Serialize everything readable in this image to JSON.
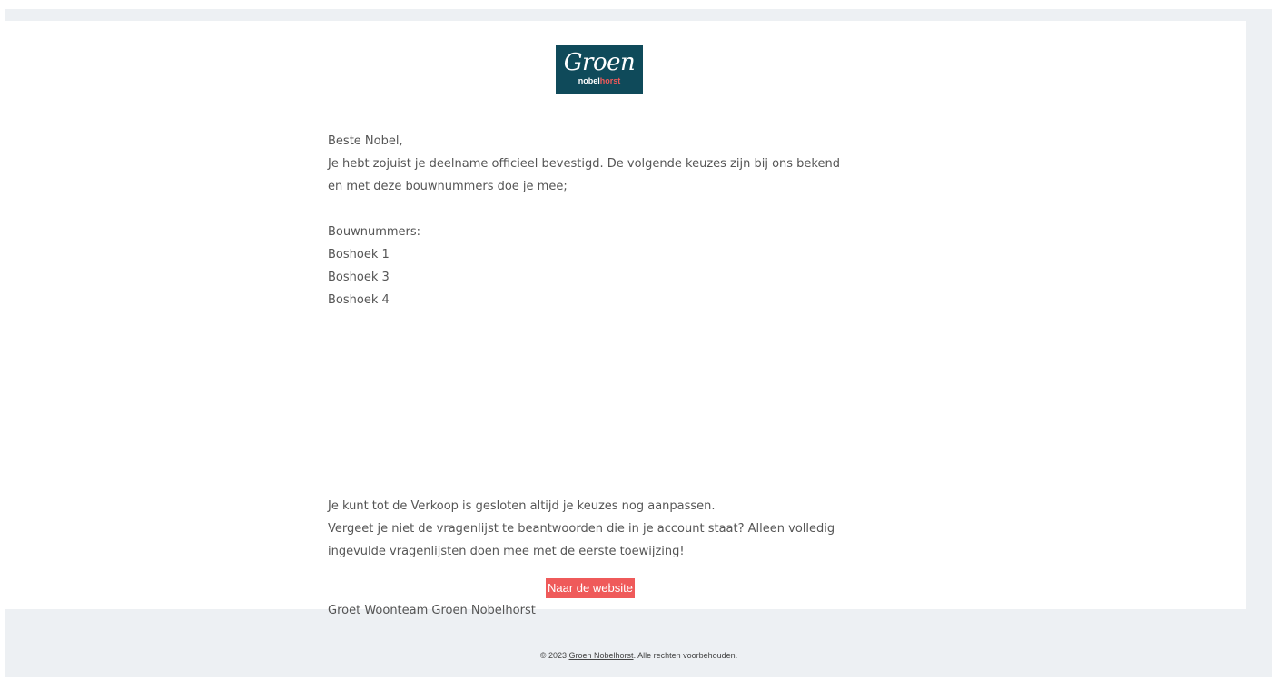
{
  "logo": {
    "script_text": "Groen",
    "sub_part1": "nobel",
    "sub_part2": "horst",
    "bg_color": "#0f4a5a",
    "accent_color": "#ef5a5a"
  },
  "email": {
    "greeting": "Beste Nobel,",
    "intro_line1": "Je hebt zojuist je deelname officieel bevestigd. De volgende keuzes zijn bij ons bekend",
    "intro_line2": "en met deze bouwnummers doe je mee;",
    "bouwnummers_label": "Bouwnummers:",
    "bouwnummers": [
      "Boshoek 1",
      "Boshoek 3",
      "Boshoek 4"
    ],
    "closing_line1": "Je kunt tot de Verkoop is gesloten altijd je keuzes nog aanpassen.",
    "closing_line2": "Vergeet je niet de vragenlijst te beantwoorden die in je account staat? Alleen volledig",
    "closing_line3": "ingevulde vragenlijsten doen mee met de eerste toewijzing!",
    "button_label": "Naar de website",
    "signoff": "Groet Woonteam Groen Nobelhorst"
  },
  "footer": {
    "copyright": "© 2023",
    "link_text": "Groen Nobelhorst",
    "suffix": ". Alle rechten voorbehouden."
  },
  "colors": {
    "page_bg": "#edf0f3",
    "card_bg": "#ffffff",
    "text": "#555555",
    "button_bg": "#ef5a5a"
  }
}
